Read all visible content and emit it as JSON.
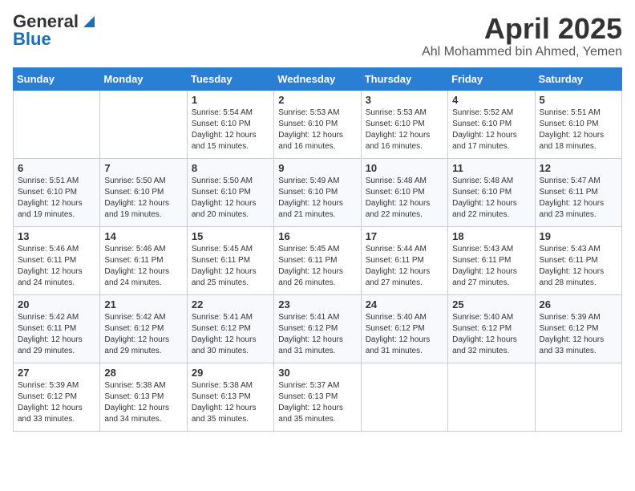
{
  "header": {
    "logo_general": "General",
    "logo_blue": "Blue",
    "month_title": "April 2025",
    "location": "Ahl Mohammed bin Ahmed, Yemen"
  },
  "weekdays": [
    "Sunday",
    "Monday",
    "Tuesday",
    "Wednesday",
    "Thursday",
    "Friday",
    "Saturday"
  ],
  "weeks": [
    [
      {
        "day": "",
        "sunrise": "",
        "sunset": "",
        "daylight": ""
      },
      {
        "day": "",
        "sunrise": "",
        "sunset": "",
        "daylight": ""
      },
      {
        "day": "1",
        "sunrise": "Sunrise: 5:54 AM",
        "sunset": "Sunset: 6:10 PM",
        "daylight": "Daylight: 12 hours and 15 minutes."
      },
      {
        "day": "2",
        "sunrise": "Sunrise: 5:53 AM",
        "sunset": "Sunset: 6:10 PM",
        "daylight": "Daylight: 12 hours and 16 minutes."
      },
      {
        "day": "3",
        "sunrise": "Sunrise: 5:53 AM",
        "sunset": "Sunset: 6:10 PM",
        "daylight": "Daylight: 12 hours and 16 minutes."
      },
      {
        "day": "4",
        "sunrise": "Sunrise: 5:52 AM",
        "sunset": "Sunset: 6:10 PM",
        "daylight": "Daylight: 12 hours and 17 minutes."
      },
      {
        "day": "5",
        "sunrise": "Sunrise: 5:51 AM",
        "sunset": "Sunset: 6:10 PM",
        "daylight": "Daylight: 12 hours and 18 minutes."
      }
    ],
    [
      {
        "day": "6",
        "sunrise": "Sunrise: 5:51 AM",
        "sunset": "Sunset: 6:10 PM",
        "daylight": "Daylight: 12 hours and 19 minutes."
      },
      {
        "day": "7",
        "sunrise": "Sunrise: 5:50 AM",
        "sunset": "Sunset: 6:10 PM",
        "daylight": "Daylight: 12 hours and 19 minutes."
      },
      {
        "day": "8",
        "sunrise": "Sunrise: 5:50 AM",
        "sunset": "Sunset: 6:10 PM",
        "daylight": "Daylight: 12 hours and 20 minutes."
      },
      {
        "day": "9",
        "sunrise": "Sunrise: 5:49 AM",
        "sunset": "Sunset: 6:10 PM",
        "daylight": "Daylight: 12 hours and 21 minutes."
      },
      {
        "day": "10",
        "sunrise": "Sunrise: 5:48 AM",
        "sunset": "Sunset: 6:10 PM",
        "daylight": "Daylight: 12 hours and 22 minutes."
      },
      {
        "day": "11",
        "sunrise": "Sunrise: 5:48 AM",
        "sunset": "Sunset: 6:10 PM",
        "daylight": "Daylight: 12 hours and 22 minutes."
      },
      {
        "day": "12",
        "sunrise": "Sunrise: 5:47 AM",
        "sunset": "Sunset: 6:11 PM",
        "daylight": "Daylight: 12 hours and 23 minutes."
      }
    ],
    [
      {
        "day": "13",
        "sunrise": "Sunrise: 5:46 AM",
        "sunset": "Sunset: 6:11 PM",
        "daylight": "Daylight: 12 hours and 24 minutes."
      },
      {
        "day": "14",
        "sunrise": "Sunrise: 5:46 AM",
        "sunset": "Sunset: 6:11 PM",
        "daylight": "Daylight: 12 hours and 24 minutes."
      },
      {
        "day": "15",
        "sunrise": "Sunrise: 5:45 AM",
        "sunset": "Sunset: 6:11 PM",
        "daylight": "Daylight: 12 hours and 25 minutes."
      },
      {
        "day": "16",
        "sunrise": "Sunrise: 5:45 AM",
        "sunset": "Sunset: 6:11 PM",
        "daylight": "Daylight: 12 hours and 26 minutes."
      },
      {
        "day": "17",
        "sunrise": "Sunrise: 5:44 AM",
        "sunset": "Sunset: 6:11 PM",
        "daylight": "Daylight: 12 hours and 27 minutes."
      },
      {
        "day": "18",
        "sunrise": "Sunrise: 5:43 AM",
        "sunset": "Sunset: 6:11 PM",
        "daylight": "Daylight: 12 hours and 27 minutes."
      },
      {
        "day": "19",
        "sunrise": "Sunrise: 5:43 AM",
        "sunset": "Sunset: 6:11 PM",
        "daylight": "Daylight: 12 hours and 28 minutes."
      }
    ],
    [
      {
        "day": "20",
        "sunrise": "Sunrise: 5:42 AM",
        "sunset": "Sunset: 6:11 PM",
        "daylight": "Daylight: 12 hours and 29 minutes."
      },
      {
        "day": "21",
        "sunrise": "Sunrise: 5:42 AM",
        "sunset": "Sunset: 6:12 PM",
        "daylight": "Daylight: 12 hours and 29 minutes."
      },
      {
        "day": "22",
        "sunrise": "Sunrise: 5:41 AM",
        "sunset": "Sunset: 6:12 PM",
        "daylight": "Daylight: 12 hours and 30 minutes."
      },
      {
        "day": "23",
        "sunrise": "Sunrise: 5:41 AM",
        "sunset": "Sunset: 6:12 PM",
        "daylight": "Daylight: 12 hours and 31 minutes."
      },
      {
        "day": "24",
        "sunrise": "Sunrise: 5:40 AM",
        "sunset": "Sunset: 6:12 PM",
        "daylight": "Daylight: 12 hours and 31 minutes."
      },
      {
        "day": "25",
        "sunrise": "Sunrise: 5:40 AM",
        "sunset": "Sunset: 6:12 PM",
        "daylight": "Daylight: 12 hours and 32 minutes."
      },
      {
        "day": "26",
        "sunrise": "Sunrise: 5:39 AM",
        "sunset": "Sunset: 6:12 PM",
        "daylight": "Daylight: 12 hours and 33 minutes."
      }
    ],
    [
      {
        "day": "27",
        "sunrise": "Sunrise: 5:39 AM",
        "sunset": "Sunset: 6:12 PM",
        "daylight": "Daylight: 12 hours and 33 minutes."
      },
      {
        "day": "28",
        "sunrise": "Sunrise: 5:38 AM",
        "sunset": "Sunset: 6:13 PM",
        "daylight": "Daylight: 12 hours and 34 minutes."
      },
      {
        "day": "29",
        "sunrise": "Sunrise: 5:38 AM",
        "sunset": "Sunset: 6:13 PM",
        "daylight": "Daylight: 12 hours and 35 minutes."
      },
      {
        "day": "30",
        "sunrise": "Sunrise: 5:37 AM",
        "sunset": "Sunset: 6:13 PM",
        "daylight": "Daylight: 12 hours and 35 minutes."
      },
      {
        "day": "",
        "sunrise": "",
        "sunset": "",
        "daylight": ""
      },
      {
        "day": "",
        "sunrise": "",
        "sunset": "",
        "daylight": ""
      },
      {
        "day": "",
        "sunrise": "",
        "sunset": "",
        "daylight": ""
      }
    ]
  ]
}
